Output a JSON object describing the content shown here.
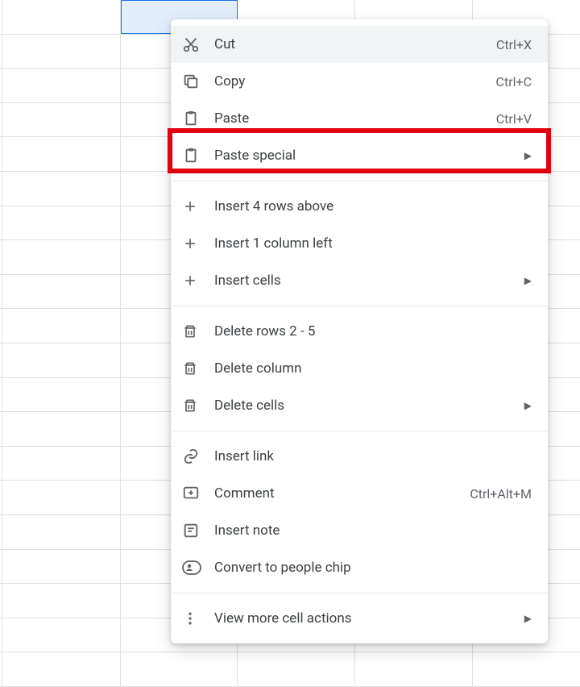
{
  "menu": {
    "cut": {
      "label": "Cut",
      "shortcut": "Ctrl+X"
    },
    "copy": {
      "label": "Copy",
      "shortcut": "Ctrl+C"
    },
    "paste": {
      "label": "Paste",
      "shortcut": "Ctrl+V"
    },
    "paste_special": {
      "label": "Paste special"
    },
    "insert_rows": {
      "label": "Insert 4 rows above"
    },
    "insert_col": {
      "label": "Insert 1 column left"
    },
    "insert_cells": {
      "label": "Insert cells"
    },
    "delete_rows": {
      "label": "Delete rows 2 - 5"
    },
    "delete_col": {
      "label": "Delete column"
    },
    "delete_cells": {
      "label": "Delete cells"
    },
    "insert_link": {
      "label": "Insert link"
    },
    "comment": {
      "label": "Comment",
      "shortcut": "Ctrl+Alt+M"
    },
    "insert_note": {
      "label": "Insert note"
    },
    "people_chip": {
      "label": "Convert to people chip"
    },
    "more_actions": {
      "label": "View more cell actions"
    }
  }
}
